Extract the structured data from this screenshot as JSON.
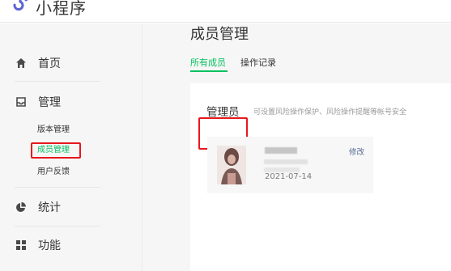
{
  "app": {
    "title": "小程序",
    "accent": "#07c160",
    "highlight": "#e8171c"
  },
  "sidebar": {
    "items": [
      {
        "label": "首页",
        "icon": "home-icon"
      },
      {
        "label": "管理",
        "icon": "inbox-icon"
      },
      {
        "label": "统计",
        "icon": "pie-chart-icon"
      },
      {
        "label": "功能",
        "icon": "grid-icon"
      }
    ],
    "sub": [
      {
        "label": "版本管理"
      },
      {
        "label": "成员管理"
      },
      {
        "label": "用户反馈"
      }
    ]
  },
  "main": {
    "title": "成员管理",
    "tabs": [
      {
        "label": "所有成员"
      },
      {
        "label": "操作记录"
      }
    ],
    "admin": {
      "title": "管理员",
      "desc": "可设置风险操作保护、风险操作提醒等帐号安全",
      "member": {
        "date": "2021-07-14",
        "edit": "修改"
      }
    }
  }
}
